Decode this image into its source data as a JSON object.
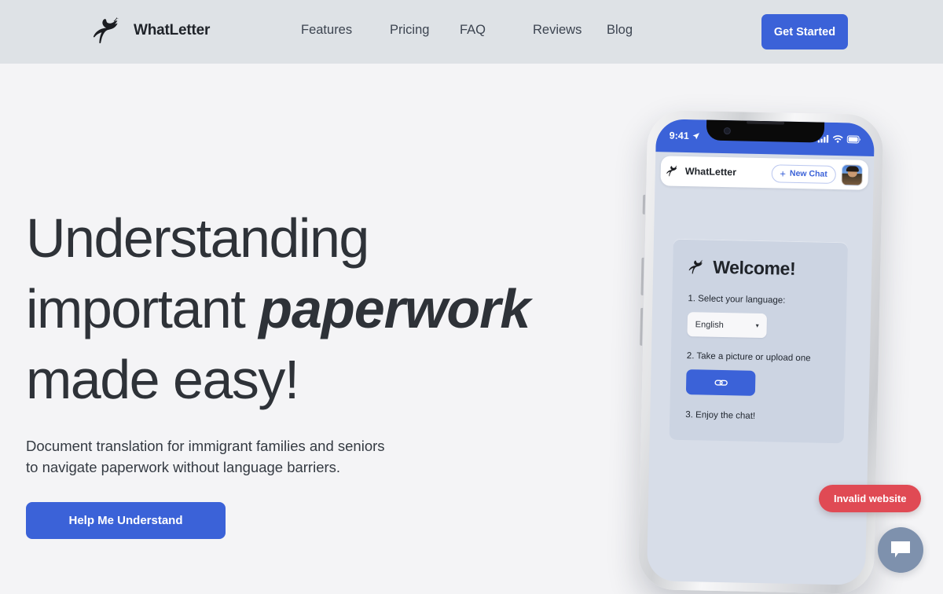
{
  "brand": {
    "name": "WhatLetter",
    "logo_icon": "dove-bird-icon"
  },
  "nav": {
    "items": [
      {
        "label": "Features"
      },
      {
        "label": "Pricing"
      },
      {
        "label": "FAQ"
      },
      {
        "label": "Reviews"
      },
      {
        "label": "Blog"
      }
    ],
    "cta_label": "Get Started"
  },
  "hero": {
    "headline_line1": "Understanding",
    "headline_line2_prefix": "important ",
    "headline_line2_emphasis": "paperwork",
    "headline_line3": "made easy!",
    "subhead_line1": "Document translation for immigrant families and seniors",
    "subhead_line2": "to navigate paperwork without language barriers.",
    "cta_label": "Help Me Understand"
  },
  "phone": {
    "status": {
      "time": "9:41",
      "location_icon": "location-arrow-icon",
      "signal_icon": "cellular-signal-icon",
      "wifi_icon": "wifi-icon",
      "battery_icon": "battery-full-icon"
    },
    "app_bar": {
      "brand": "WhatLetter",
      "new_chat_label": "New Chat",
      "new_chat_plus": "+",
      "avatar_name": "user-avatar"
    },
    "welcome": {
      "title": "Welcome!",
      "logo_icon": "dove-bird-icon",
      "step1_label": "1. Select your language:",
      "language_value": "English",
      "language_caret": "▾",
      "step2_label": "2. Take a picture or upload one",
      "upload_icon": "paperclip-link-icon",
      "step3_label": "3. Enjoy the chat!"
    }
  },
  "overlays": {
    "invalid_badge": "Invalid website",
    "chat_widget_icon": "chat-bubble-icon"
  },
  "colors": {
    "accent_blue": "#3b62d8",
    "header_bg": "#dee2e6",
    "page_bg": "#f4f4f6",
    "phone_screen_bg": "#d7dde8",
    "card_bg": "#ccd4e2",
    "danger_red": "#e04a54",
    "chat_widget_bg": "#7e91ad"
  }
}
